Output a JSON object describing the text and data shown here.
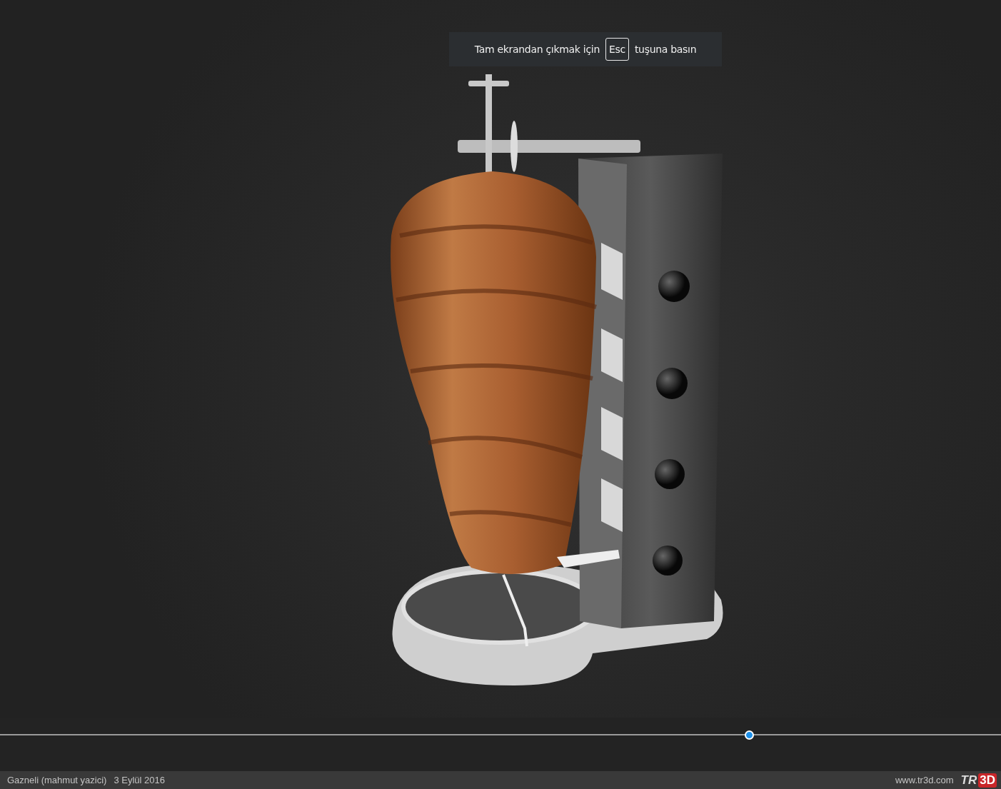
{
  "notice": {
    "before": "Tam ekrandan çıkmak için",
    "key": "Esc",
    "after": "tuşuna basın"
  },
  "timeline": {
    "level": 0.748
  },
  "footer": {
    "author": "Gazneli (mahmut yazici)",
    "date": "3 Eylül 2016",
    "site": "www.tr3d.com",
    "logo": [
      "TR",
      "3D"
    ]
  }
}
